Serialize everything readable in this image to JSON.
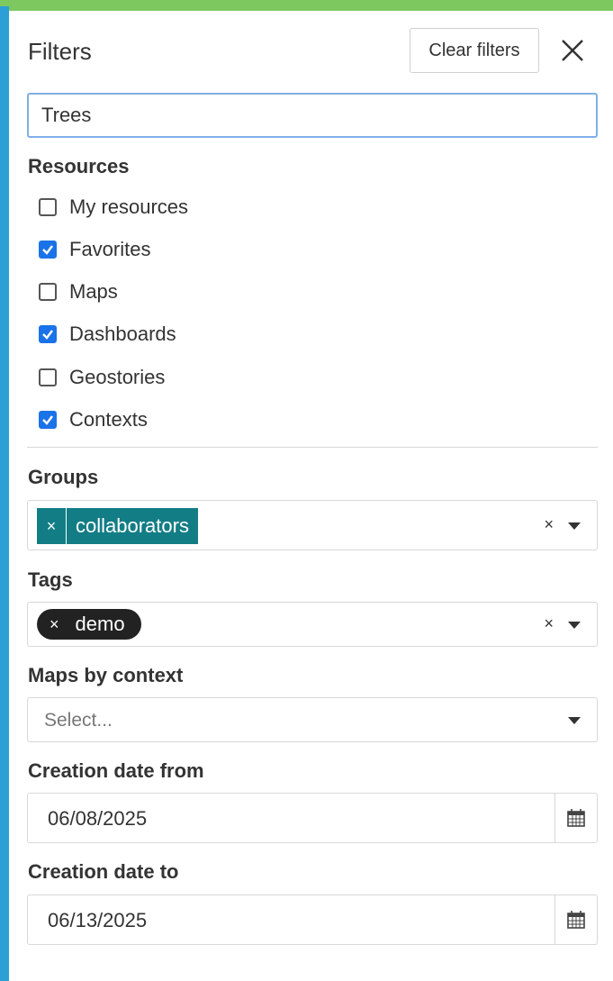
{
  "panel": {
    "title": "Filters",
    "clear_label": "Clear filters"
  },
  "search": {
    "value": "Trees"
  },
  "resources": {
    "label": "Resources",
    "items": [
      {
        "label": "My resources",
        "checked": false
      },
      {
        "label": "Favorites",
        "checked": true
      },
      {
        "label": "Maps",
        "checked": false
      },
      {
        "label": "Dashboards",
        "checked": true
      },
      {
        "label": "Geostories",
        "checked": false
      },
      {
        "label": "Contexts",
        "checked": true
      }
    ]
  },
  "groups": {
    "label": "Groups",
    "selected": "collaborators",
    "remove": "×",
    "clear": "×"
  },
  "tags": {
    "label": "Tags",
    "selected": "demo",
    "remove": "×",
    "clear": "×"
  },
  "maps_by_context": {
    "label": "Maps by context",
    "placeholder": "Select..."
  },
  "creation_from": {
    "label": "Creation date from",
    "value": "06/08/2025"
  },
  "creation_to": {
    "label": "Creation date to",
    "value": "06/13/2025"
  },
  "colors": {
    "accent": "#137d86",
    "checkbox": "#1a73e8",
    "focus": "#7fb0e6"
  }
}
